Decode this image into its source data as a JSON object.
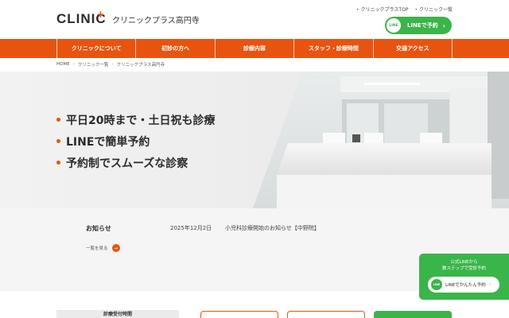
{
  "header": {
    "logo": "CLINIC",
    "logo_plus": "+",
    "site_name": "クリニックプラス高円寺",
    "top_links": [
      "クリニックプラスTOP",
      "クリニック一覧"
    ],
    "line_button": {
      "badge": "LINE",
      "label": "LINEで予約",
      "arrow": "›"
    }
  },
  "nav": [
    "クリニックについて",
    "初診の方へ",
    "診療内容",
    "スタッフ・診療時間",
    "交通アクセス"
  ],
  "breadcrumb": [
    "HOME",
    "クリニック一覧",
    "クリニックプラス高円寺"
  ],
  "hero": {
    "lines": [
      "平日20時まで・土日祝も診療",
      "LINEで簡単予約",
      "予約制でスムーズな診察"
    ]
  },
  "news": {
    "title": "お知らせ",
    "items": [
      {
        "date": "2025年12月2日",
        "text": "小児科診療開始のお知らせ【中野院】"
      }
    ],
    "more": "一覧を見る"
  },
  "float": {
    "line1": "公式LINEから",
    "line2": "数ステップで受診予約",
    "badge": "LINE",
    "button": "LINEでかんたん予約",
    "arrow": "›"
  },
  "hours": {
    "title": "診療受付時間"
  },
  "colors": {
    "accent": "#e8540f",
    "line_green": "#3ab54a"
  }
}
